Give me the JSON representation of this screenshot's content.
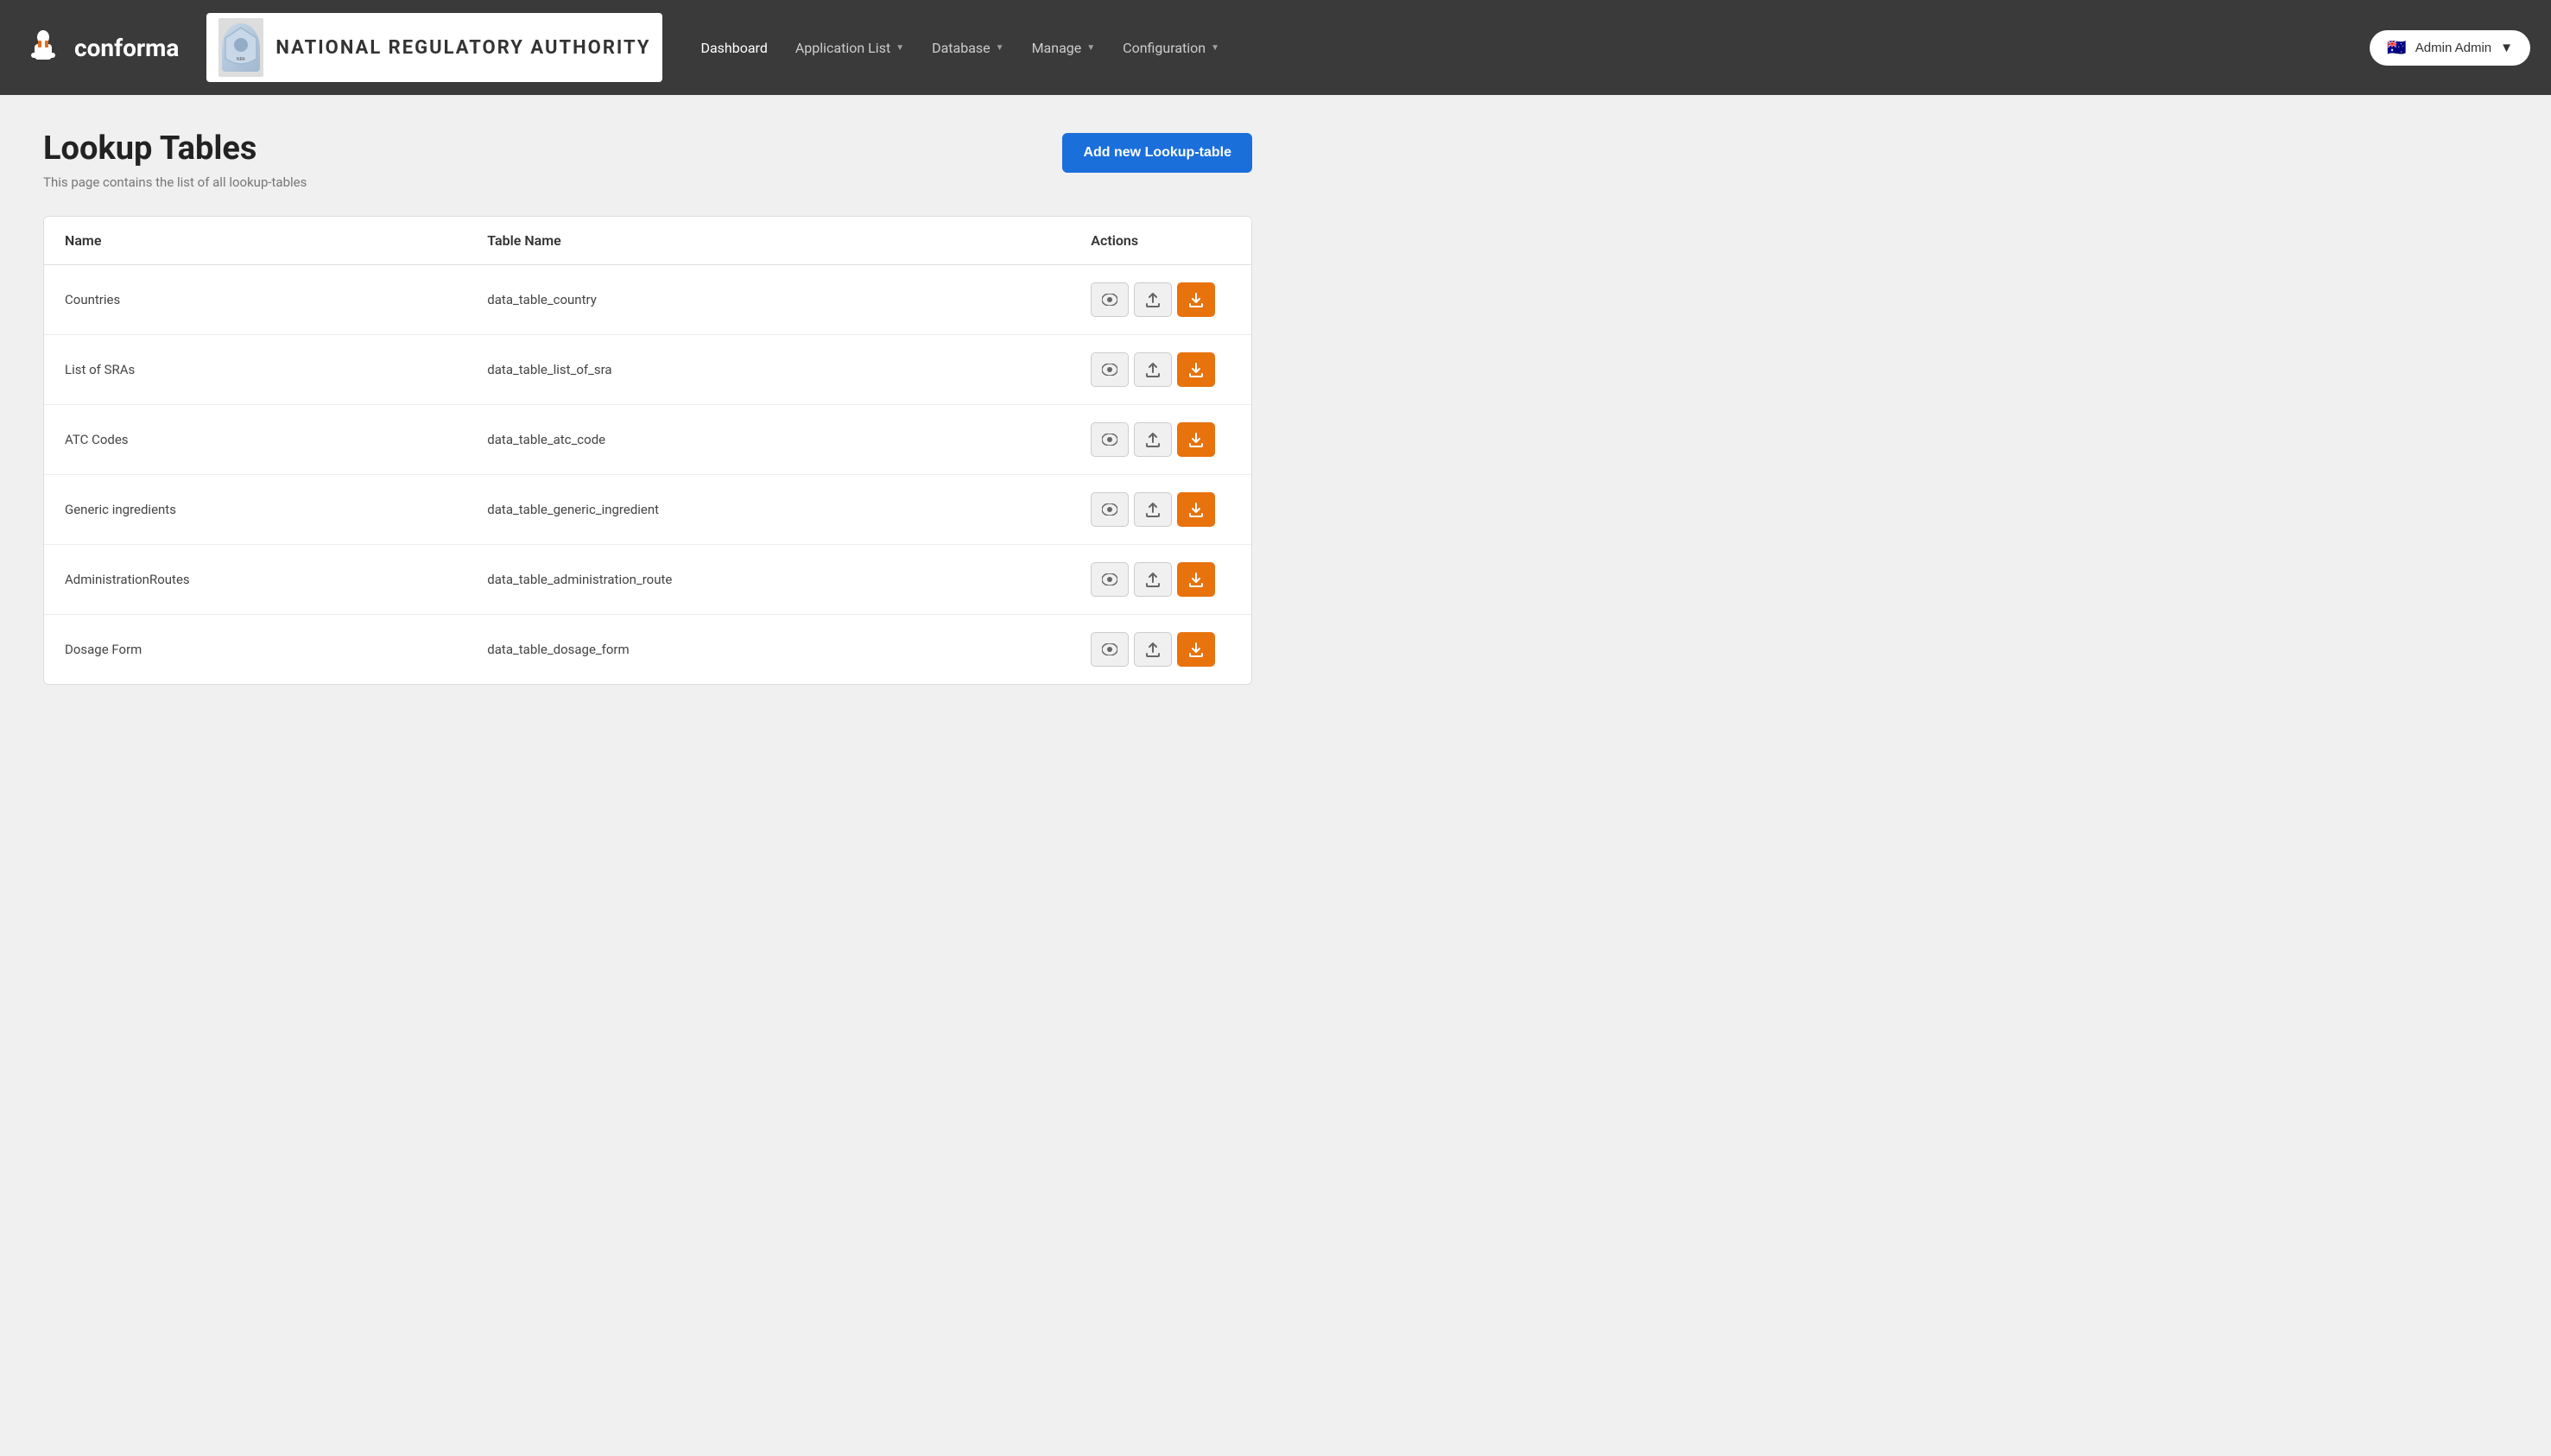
{
  "brand": {
    "name": "conforma",
    "logo_alt": "conforma logo"
  },
  "org": {
    "name": "NATIONAL REGULATORY AUTHORITY"
  },
  "nav": {
    "items": [
      {
        "label": "Dashboard",
        "has_dropdown": false
      },
      {
        "label": "Application List",
        "has_dropdown": true
      },
      {
        "label": "Database",
        "has_dropdown": true
      },
      {
        "label": "Manage",
        "has_dropdown": true
      },
      {
        "label": "Configuration",
        "has_dropdown": true
      }
    ]
  },
  "user": {
    "name": "Admin Admin",
    "flag": "🇦🇺"
  },
  "page": {
    "title": "Lookup Tables",
    "subtitle": "This page contains the list of all lookup-tables",
    "add_button_label": "Add new Lookup-table"
  },
  "table": {
    "columns": [
      "Name",
      "Table Name",
      "Actions"
    ],
    "rows": [
      {
        "name": "Countries",
        "table_name": "data_table_country"
      },
      {
        "name": "List of SRAs",
        "table_name": "data_table_list_of_sra"
      },
      {
        "name": "ATC Codes",
        "table_name": "data_table_atc_code"
      },
      {
        "name": "Generic ingredients",
        "table_name": "data_table_generic_ingredient"
      },
      {
        "name": "AdministrationRoutes",
        "table_name": "data_table_administration_route"
      },
      {
        "name": "Dosage Form",
        "table_name": "data_table_dosage_form"
      }
    ]
  }
}
